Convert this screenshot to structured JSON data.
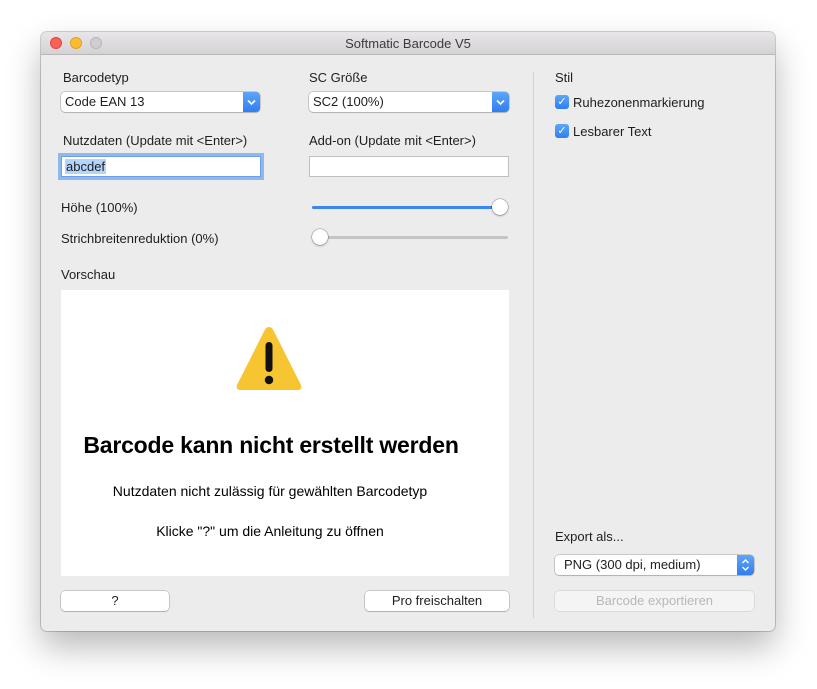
{
  "window": {
    "title": "Softmatic Barcode V5"
  },
  "left": {
    "barcodetyp_label": "Barcodetyp",
    "barcodetyp_value": "Code EAN 13",
    "sc_label": "SC Größe",
    "sc_value": "SC2 (100%)",
    "nutzdaten_label": "Nutzdaten (Update mit <Enter>)",
    "nutzdaten_value": "abcdef",
    "addon_label": "Add-on (Update mit <Enter>)",
    "addon_value": "",
    "hoehe_label": "Höhe (100%)",
    "hoehe_level": 1.0,
    "strich_label": "Strichbreitenreduktion (0%)",
    "strich_level": 0.0,
    "vorschau_label": "Vorschau"
  },
  "preview": {
    "error_title": "Barcode kann nicht erstellt werden",
    "error_line1": "Nutzdaten nicht zulässig für gewählten Barcodetyp",
    "error_line2": "Klicke \"?\" um die Anleitung zu öffnen",
    "icon": "warning-triangle-icon"
  },
  "buttons": {
    "help": "?",
    "pro": "Pro freischalten",
    "export": "Barcode exportieren"
  },
  "right": {
    "stil_label": "Stil",
    "cb1_label": "Ruhezonenmarkierung",
    "cb1_checked": true,
    "cb2_label": "Lesbarer Text",
    "cb2_checked": true,
    "export_label": "Export als...",
    "export_value": "PNG (300 dpi, medium)"
  },
  "colors": {
    "accent": "#3b86f0",
    "warning": "#f7c531"
  }
}
